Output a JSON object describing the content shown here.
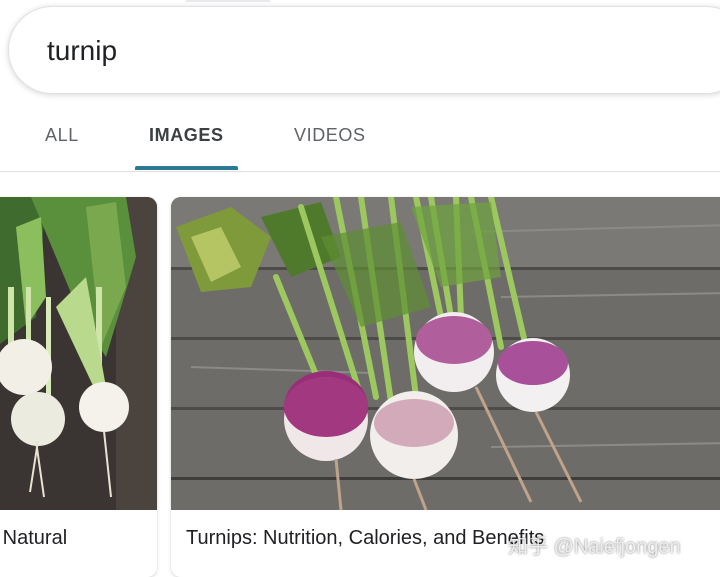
{
  "search": {
    "query": "turnip"
  },
  "tabs": [
    {
      "label": "ALL",
      "active": false
    },
    {
      "label": "IMAGES",
      "active": true
    },
    {
      "label": "VIDEOS",
      "active": false
    }
  ],
  "accent_color": "#2b7a95",
  "results": [
    {
      "caption": "e Natural"
    },
    {
      "caption": "Turnips: Nutrition, Calories, and Benefits"
    }
  ],
  "watermark": "知乎 @Naiefjongen"
}
